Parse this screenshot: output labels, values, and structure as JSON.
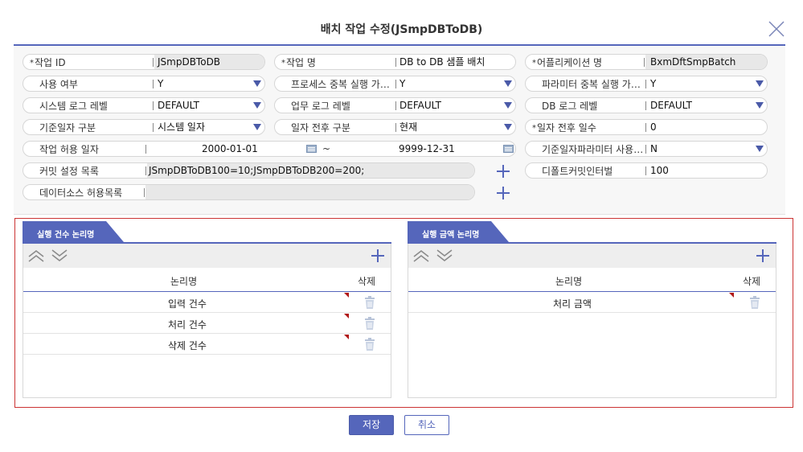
{
  "dialog": {
    "title": "배치 작업 수정(JSmpDBToDB)"
  },
  "form": {
    "job_id": {
      "label": "작업 ID",
      "value": "JSmpDBToDB"
    },
    "job_name": {
      "label": "작업 명",
      "value": "DB to DB 샘플 배치"
    },
    "application_name": {
      "label": "어플리케이션 명",
      "value": "BxmDftSmpBatch"
    },
    "use_yn": {
      "label": "사용 여부",
      "value": "Y"
    },
    "process_dup_exec": {
      "label": "프로세스 중복 실행 가능…",
      "value": "Y"
    },
    "param_dup_exec": {
      "label": "파라미터 중복 실행 가능…",
      "value": "Y"
    },
    "system_log_level": {
      "label": "시스템 로그 레벨",
      "value": "DEFAULT"
    },
    "business_log_level": {
      "label": "업무 로그 레벨",
      "value": "DEFAULT"
    },
    "db_log_level": {
      "label": "DB 로그 레벨",
      "value": "DEFAULT"
    },
    "base_date_type": {
      "label": "기준일자 구분",
      "value": "시스템 일자"
    },
    "date_before_after_type": {
      "label": "일자 전후 구분",
      "value": "현재"
    },
    "date_before_after_days": {
      "label": "일자 전후 일수",
      "value": "0"
    },
    "job_allowed_date": {
      "label": "작업 허용 일자",
      "from": "2000-01-01",
      "tilde": "~",
      "to": "9999-12-31"
    },
    "base_date_param_use": {
      "label": "기준일자파라미터 사용…",
      "value": "N"
    },
    "commit_setting_list": {
      "label": "커밋 설정 목록",
      "value": "JSmpDBToDB100=10;JSmpDBToDB200=200;"
    },
    "default_commit_interval": {
      "label": "디폴트커밋인터벌",
      "value": "100"
    },
    "datasource_allowed_list": {
      "label": "데이터소스 허용목록",
      "value": ""
    },
    "required_mark": "*"
  },
  "count_panel": {
    "tab_label": "실행 건수 논리명",
    "col_name": "논리명",
    "col_delete": "삭제",
    "rows": [
      "입력 건수",
      "처리 건수",
      "삭제 건수"
    ]
  },
  "amount_panel": {
    "tab_label": "실행 금액 논리명",
    "col_name": "논리명",
    "col_delete": "삭제",
    "rows": [
      "처리 금액"
    ]
  },
  "buttons": {
    "save": "저장",
    "cancel": "취소"
  },
  "colors": {
    "accent": "#5566bb",
    "highlight_border": "#cc3333",
    "flag": "#b01818"
  },
  "icons": [
    "close-icon",
    "chevron-down-icon",
    "calendar-icon",
    "plus-icon",
    "move-up-icon",
    "move-down-icon",
    "trash-icon"
  ]
}
